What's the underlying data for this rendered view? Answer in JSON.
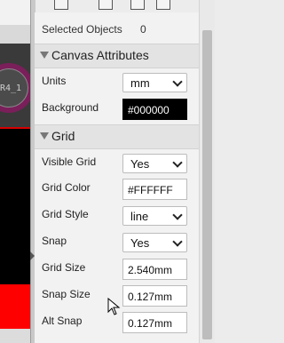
{
  "header": {
    "selected_label": "Selected Objects",
    "selected_count": "0"
  },
  "canvas_attributes": {
    "title": "Canvas Attributes",
    "units": {
      "label": "Units",
      "value": "mm"
    },
    "background": {
      "label": "Background",
      "value": "#000000"
    }
  },
  "grid": {
    "title": "Grid",
    "visible_grid": {
      "label": "Visible Grid",
      "value": "Yes"
    },
    "grid_color": {
      "label": "Grid Color",
      "value": "#FFFFFF"
    },
    "grid_style": {
      "label": "Grid Style",
      "value": "line"
    },
    "snap": {
      "label": "Snap",
      "value": "Yes"
    },
    "grid_size": {
      "label": "Grid Size",
      "value": "2.540mm"
    },
    "snap_size": {
      "label": "Snap Size",
      "value": "0.127mm"
    },
    "alt_snap": {
      "label": "Alt Snap",
      "value": "0.127mm"
    }
  },
  "canvas": {
    "pad_label": "R4_1"
  },
  "colors": {
    "pad_ring": "#7a1f5a",
    "canvas_bg": "#000000",
    "board_line": "#d60000",
    "copper_red": "#ff0000"
  }
}
